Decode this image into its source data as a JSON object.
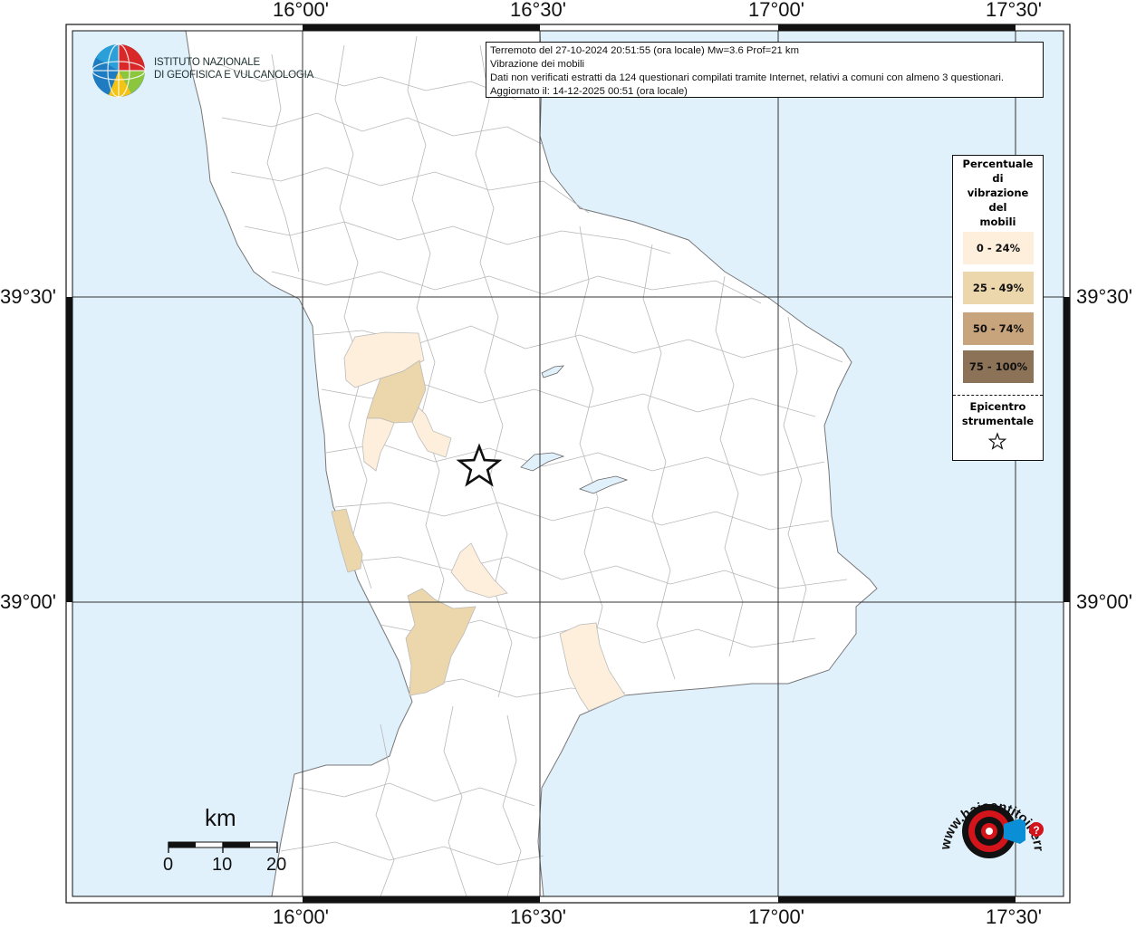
{
  "map": {
    "lon_labels": [
      "16°00'",
      "16°30'",
      "17°00'",
      "17°30'"
    ],
    "lat_labels": [
      "39°30'",
      "39°00'"
    ],
    "colors": {
      "sea": "#e1f1fc",
      "land": "#ffffff",
      "boundary": "#b8b8b8",
      "frame": "#111111"
    }
  },
  "info": {
    "line1": "Terremoto del 27-10-2024 20:51:55 (ora locale) Mw=3.6 Prof=21 km",
    "line2": "Vibrazione dei mobili",
    "line3": "Dati non verificati estratti da 124 questionari compilati tramite Internet, relativi a comuni con almeno 3 questionari.",
    "line4": "Aggiornato il: 14-12-2025 00:51 (ora locale)"
  },
  "legend": {
    "title_lines": [
      "Percentuale",
      "di",
      "vibrazione",
      "del",
      "mobili"
    ],
    "classes": [
      {
        "label": "0 - 24%",
        "color": "#fdefdc"
      },
      {
        "label": "25 - 49%",
        "color": "#ecd6ab"
      },
      {
        "label": "50 - 74%",
        "color": "#c8a47c"
      },
      {
        "label": "75 - 100%",
        "color": "#8c7358"
      }
    ],
    "epicenter_lines": [
      "Epicentro",
      "strumentale"
    ],
    "epicenter_icon": "star-outline-icon"
  },
  "logo": {
    "lines": [
      "ISTITUTO NAZIONALE",
      "DI GEOFISICA E VULCANOLOGIA"
    ],
    "icon": "ingv-globe-icon"
  },
  "scale": {
    "unit": "km",
    "ticks": [
      "0",
      "10",
      "20"
    ]
  },
  "badge": {
    "text": "www.haisentitoilterremoto.it",
    "icon": "haisentito-target-icon",
    "colors": {
      "red": "#d4141b",
      "blue": "#0a8fd6"
    }
  }
}
